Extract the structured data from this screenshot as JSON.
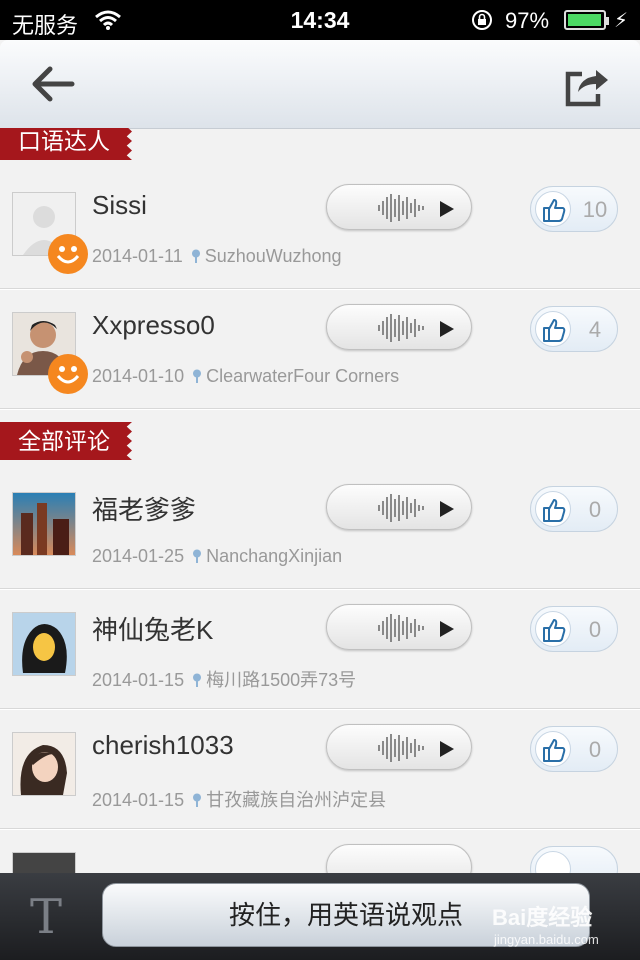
{
  "status_bar": {
    "carrier": "无服务",
    "time": "14:34",
    "battery_pct": "97%",
    "battery_level": 0.97,
    "icons": [
      "wifi-icon",
      "orientation-lock-icon",
      "battery-icon",
      "charging-bolt-icon"
    ]
  },
  "nav": {
    "back_icon": "arrow-left-icon",
    "share_icon": "share-icon"
  },
  "sections": {
    "top": "口语达人",
    "all": "全部评论"
  },
  "top_comments": [
    {
      "name": "Sissi",
      "date": "2014-01-11",
      "location": "SuzhouWuzhong",
      "likes": "10",
      "badge": true
    },
    {
      "name": "Xxpresso0",
      "date": "2014-01-10",
      "location": "ClearwaterFour Corners",
      "likes": "4",
      "badge": true
    }
  ],
  "all_comments": [
    {
      "name": "福老爹爹",
      "date": "2014-01-25",
      "location": "NanchangXinjian",
      "likes": "0"
    },
    {
      "name": "神仙兔老K",
      "date": "2014-01-15",
      "location": "梅川路1500弄73号",
      "likes": "0"
    },
    {
      "name": "cherish1033",
      "date": "2014-01-15",
      "location": "甘孜藏族自治州泸定县",
      "likes": "0"
    }
  ],
  "bottom": {
    "text_mode_label": "T",
    "hold_button": "按住，用英语说观点"
  },
  "watermark": {
    "line1": "Bai度经验",
    "line2": "jingyan.baidu.com"
  },
  "colors": {
    "ribbon": "#a5171c",
    "like_icon": "#2a6fa8",
    "badge": "#f5871f"
  }
}
